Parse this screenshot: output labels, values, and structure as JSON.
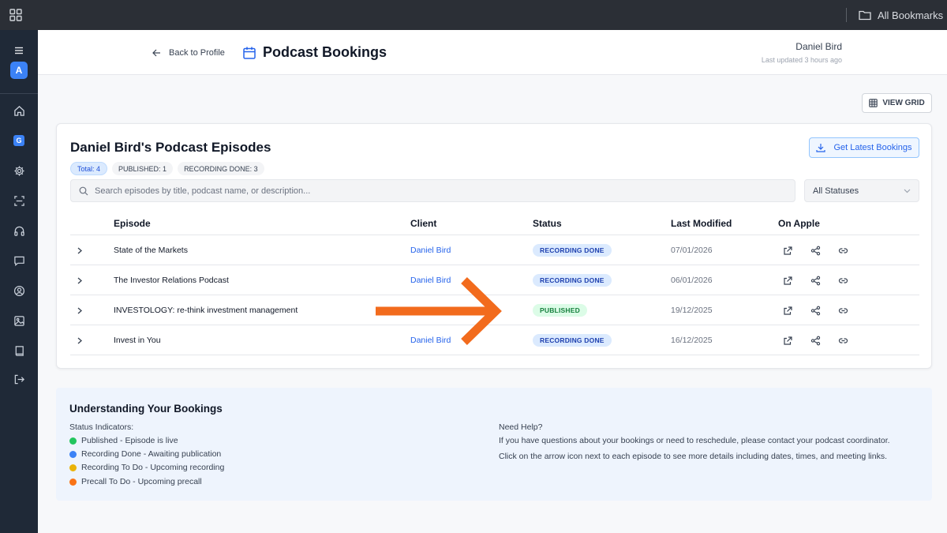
{
  "topbar": {
    "bookmarks_label": "All Bookmarks"
  },
  "sidebar": {
    "avatar_letter": "A",
    "g_letter": "G"
  },
  "header": {
    "back_label": "Back to Profile",
    "page_title": "Podcast Bookings",
    "user_name": "Daniel Bird",
    "last_updated": "Last updated 3 hours ago"
  },
  "toolbar": {
    "view_grid_label": "VIEW GRID"
  },
  "card": {
    "title": "Daniel Bird's Podcast Episodes",
    "get_bookings_label": "Get Latest Bookings",
    "pills": [
      "Total: 4",
      "PUBLISHED: 1",
      "RECORDING DONE: 3"
    ],
    "search_placeholder": "Search episodes by title, podcast name, or description...",
    "status_filter": "All Statuses",
    "columns": {
      "episode": "Episode",
      "client": "Client",
      "status": "Status",
      "last_modified": "Last Modified",
      "on_apple": "On Apple"
    },
    "rows": [
      {
        "episode": "State of the Markets",
        "client": "Daniel Bird",
        "status": "RECORDING DONE",
        "last_modified": "07/01/2026"
      },
      {
        "episode": "The Investor Relations Podcast",
        "client": "Daniel Bird",
        "status": "RECORDING DONE",
        "last_modified": "06/01/2026"
      },
      {
        "episode": "INVESTOLOGY: re-think investment management",
        "client": "",
        "status": "PUBLISHED",
        "last_modified": "19/12/2025"
      },
      {
        "episode": "Invest in You",
        "client": "Daniel Bird",
        "status": "RECORDING DONE",
        "last_modified": "16/12/2025"
      }
    ]
  },
  "info": {
    "title": "Understanding Your Bookings",
    "status_label": "Status Indicators:",
    "legend": [
      {
        "label": "Published - Episode is live",
        "color": "#22c55e"
      },
      {
        "label": "Recording Done - Awaiting publication",
        "color": "#3b82f6"
      },
      {
        "label": "Recording To Do - Upcoming recording",
        "color": "#eab308"
      },
      {
        "label": "Precall To Do - Upcoming precall",
        "color": "#f97316"
      }
    ],
    "help_title": "Need Help?",
    "help_line1": "If you have questions about your bookings or need to reschedule, please contact your podcast coordinator.",
    "help_line2": "Click on the arrow icon next to each episode to see more details including dates, times, and meeting links."
  },
  "colors": {
    "accent": "#2563eb",
    "sidebar": "#1f2937",
    "topbar": "#2b2f36",
    "annotation_arrow": "#f26b1d"
  }
}
